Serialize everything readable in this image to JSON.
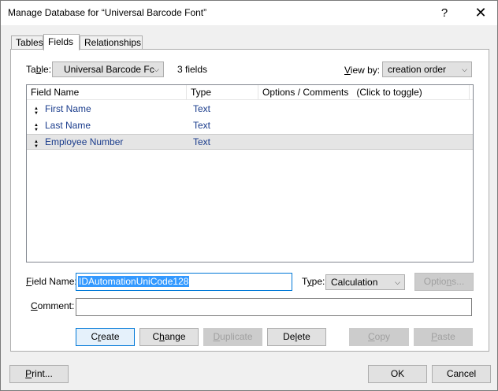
{
  "window": {
    "title": "Manage Database for “Universal Barcode Font”",
    "help_glyph": "?",
    "close_glyph": "✕"
  },
  "tabs": [
    {
      "label": "Tables",
      "active": false
    },
    {
      "label": "Fields",
      "active": true
    },
    {
      "label": "Relationships",
      "active": false
    }
  ],
  "table_selector": {
    "label_prefix": "Ta",
    "label_underlined": "b",
    "label_suffix": "le:",
    "value": "Universal Barcode Fc",
    "field_count": "3 fields"
  },
  "view_by": {
    "label_underlined": "V",
    "label_rest": "iew by:",
    "value": "creation order"
  },
  "field_list": {
    "columns": [
      "Field Name",
      "Type",
      "Options / Comments   (Click to toggle)"
    ],
    "rows": [
      {
        "name": "First Name",
        "type": "Text",
        "selected": false
      },
      {
        "name": "Last Name",
        "type": "Text",
        "selected": false
      },
      {
        "name": "Employee Number",
        "type": "Text",
        "selected": true
      }
    ],
    "grip_glyph": "▲▼"
  },
  "field_name": {
    "label_underlined": "F",
    "label_rest": "ield Name:",
    "value": "IDAutomationUniCode128"
  },
  "type": {
    "label_prefix": "T",
    "label_underlined": "y",
    "label_suffix": "pe:",
    "value": "Calculation"
  },
  "comment": {
    "label_underlined": "C",
    "label_rest": "omment:",
    "value": ""
  },
  "buttons": {
    "options": {
      "pre": "Optio",
      "u": "n",
      "post": "s..."
    },
    "create": {
      "pre": "C",
      "u": "r",
      "post": "eate"
    },
    "change": {
      "pre": "C",
      "u": "h",
      "post": "ange"
    },
    "duplicate": {
      "pre": "",
      "u": "D",
      "post": "uplicate"
    },
    "delete": {
      "pre": "De",
      "u": "l",
      "post": "ete"
    },
    "copy": {
      "pre": "",
      "u": "C",
      "post": "opy"
    },
    "paste": {
      "pre": "",
      "u": "P",
      "post": "aste"
    },
    "print": {
      "pre": "",
      "u": "P",
      "post": "rint..."
    },
    "ok": "OK",
    "cancel": "Cancel"
  }
}
